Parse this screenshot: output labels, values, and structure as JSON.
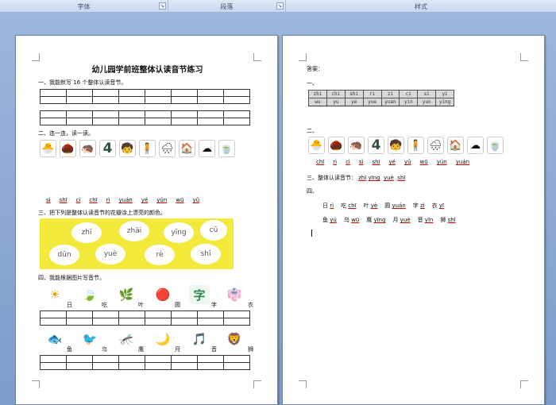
{
  "ribbon": {
    "groups": [
      "字体",
      "段落",
      "样式"
    ]
  },
  "page1": {
    "title": "幼儿园学前班整体认读音节练习",
    "q1": "一、我能默写 16 个整体认读音节。",
    "q2": "二、连一连，读一读。",
    "q2_icons": [
      "🐣",
      "🌰",
      "🦔",
      "4",
      "🧒",
      "🧍",
      "🌧",
      "🏠",
      "☁",
      "🍵"
    ],
    "q2_pinyin": [
      "sì",
      "shī",
      "cì",
      "chī",
      "rì",
      "yuán",
      "yé",
      "yún",
      "wū",
      "yǔ"
    ],
    "q3": "三、把下列是整体认读音节的花瓣涂上漂亮的颜色。",
    "q3_flowers": [
      "zhī",
      "zhāi",
      "yīng",
      "cū",
      "dūn",
      "yuè",
      "rè",
      "shī"
    ],
    "q4": "四、我能根据图片写音节。",
    "q4_row1_icons": [
      "☀",
      "🍃",
      "🌿",
      "🔴",
      "字",
      "👘"
    ],
    "q4_row1_hints": [
      "日",
      "吃",
      "叶",
      "圆",
      "字",
      "衣"
    ],
    "q4_row2_icons": [
      "🐟",
      "🐦",
      "🦟",
      "🌙",
      "🎵",
      "🦁"
    ],
    "q4_row2_hints": [
      "鱼",
      "乌",
      "鹰",
      "月",
      "音",
      "狮"
    ]
  },
  "page2": {
    "answer_label": "答案：",
    "a1": "一、",
    "a1_image": [
      "zhi",
      "chi",
      "shi",
      "ri",
      "zi",
      "ci",
      "si",
      "yi",
      "wu",
      "yu",
      "ye",
      "yue",
      "yuan",
      "yin",
      "yun",
      "ying"
    ],
    "a2": "二、",
    "a2_icons": [
      "🐣",
      "🌰",
      "🦔",
      "4",
      "🧒",
      "🧍",
      "🌧",
      "🏠",
      "☁",
      "🍵"
    ],
    "a2_pinyin": [
      "chī",
      "rì",
      "cì",
      "sì",
      "shī",
      "yé",
      "yǔ",
      "wū",
      "yún",
      "yuán"
    ],
    "a3_label": "三、整体认读音节：",
    "a3_values": [
      "zhī",
      "yīng",
      "yuè",
      "shī"
    ],
    "a4": "四、",
    "a4_row1": [
      {
        "han": "日",
        "py": "rì"
      },
      {
        "han": "吃",
        "py": "chī"
      },
      {
        "han": "叶",
        "py": "yè"
      },
      {
        "han": "圆",
        "py": "yuán"
      },
      {
        "han": "字",
        "py": "zì"
      },
      {
        "han": "衣",
        "py": "yī"
      }
    ],
    "a4_row2": [
      {
        "han": "鱼",
        "py": "yú"
      },
      {
        "han": "乌",
        "py": "wū"
      },
      {
        "han": "鹰",
        "py": "yīng"
      },
      {
        "han": "月",
        "py": "yuè"
      },
      {
        "han": "音",
        "py": "yīn"
      },
      {
        "han": "狮",
        "py": "shī"
      }
    ]
  },
  "colors": {
    "flower_board": "#f2e93a",
    "error_underline": "#dd0000",
    "workspace": "#8aa9d6"
  }
}
